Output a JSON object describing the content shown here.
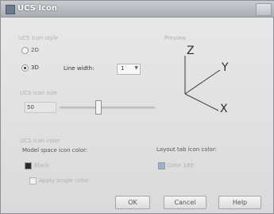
{
  "title": "UCS Icon",
  "style_group": {
    "label": "UCS icon style",
    "option_2d": "2D",
    "option_3d": "3D",
    "selected": "3D",
    "line_width_label": "Line width:",
    "line_width_value": "1"
  },
  "preview": {
    "label": "Preview",
    "axis_z": "Z",
    "axis_y": "Y",
    "axis_x": "X"
  },
  "size_group": {
    "label": "UCS icon size",
    "value": "50",
    "slider_fraction": 0.5
  },
  "color_group": {
    "label": "UCS icon color",
    "model_label": "Model space icon color:",
    "model_value": "Black",
    "model_swatch": "#2b2b2b",
    "layout_label": "Layout tab icon color:",
    "layout_value": "Color 160",
    "layout_swatch": "#9ab0cc",
    "apply_single": "Apply single color"
  },
  "buttons": {
    "ok": "OK",
    "cancel": "Cancel",
    "help": "Help"
  }
}
